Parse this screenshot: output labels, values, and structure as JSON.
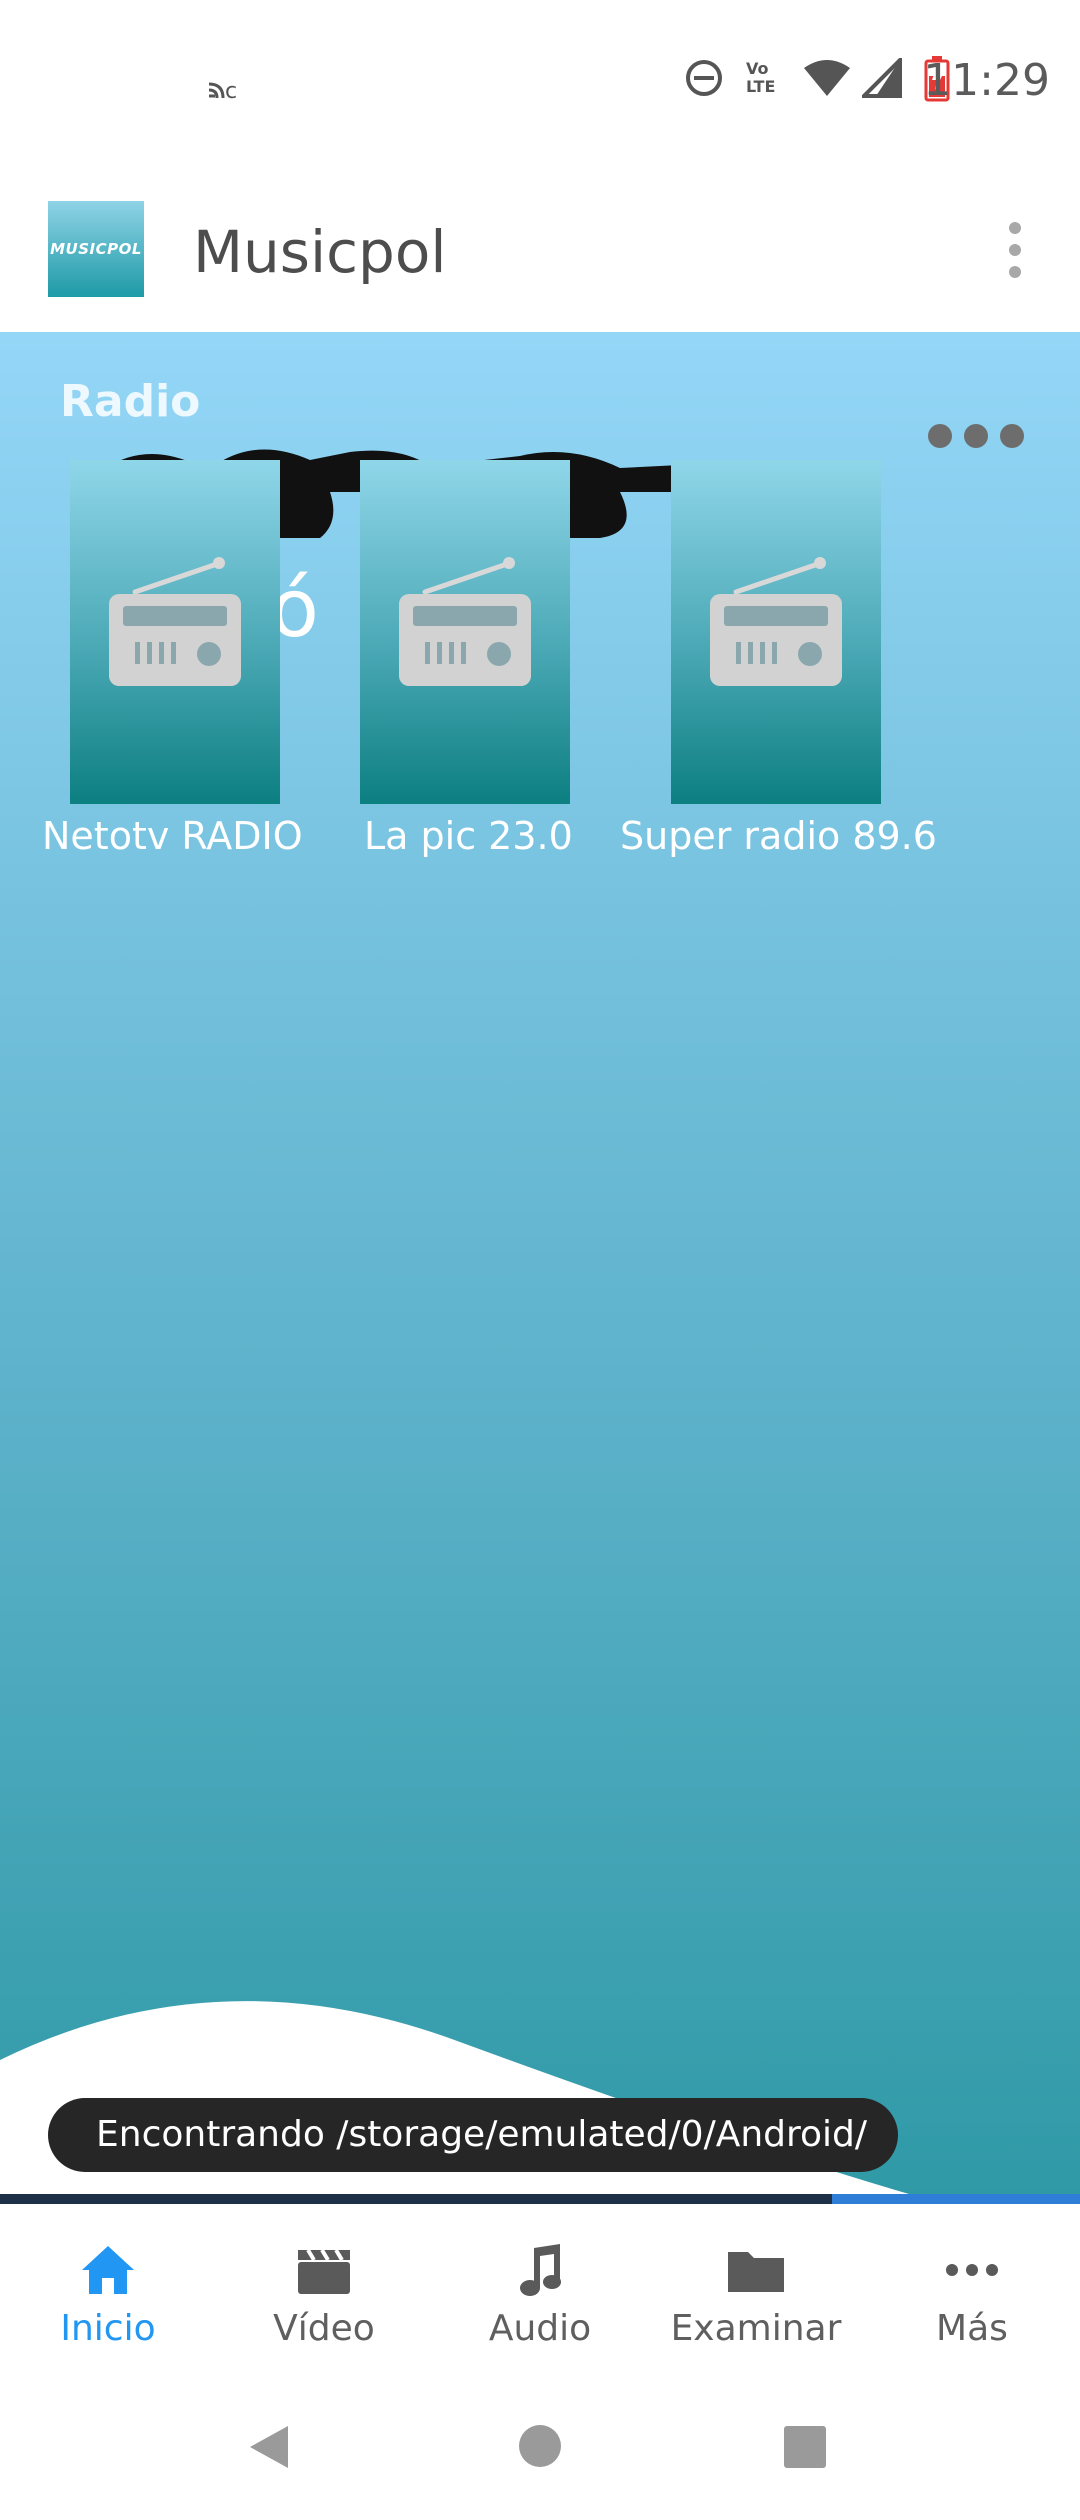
{
  "status_bar": {
    "time": "11:29",
    "network_label": "Vo LTE",
    "icons": [
      "cast-icon",
      "do-not-disturb-icon",
      "volte-icon",
      "wifi-icon",
      "cellular-signal-icon",
      "battery-charging-icon"
    ]
  },
  "app_bar": {
    "logo_text": "MUSICPOL",
    "title": "Musicpol"
  },
  "main": {
    "section_title": "Radio",
    "background_text": "ó",
    "stations": [
      {
        "label": "Netotv RADIO"
      },
      {
        "label": "La pic 23.0"
      },
      {
        "label": "Super radio 89.6"
      }
    ]
  },
  "toast": {
    "text": "Encontrando /storage/emulated/0/Android/"
  },
  "progress": {
    "fraction": 0.23
  },
  "bottom_nav": {
    "items": [
      {
        "label": "Inicio",
        "icon": "home-icon",
        "active": true
      },
      {
        "label": "Vídeo",
        "icon": "clapperboard-icon",
        "active": false
      },
      {
        "label": "Audio",
        "icon": "music-note-icon",
        "active": false
      },
      {
        "label": "Examinar",
        "icon": "folder-icon",
        "active": false
      },
      {
        "label": "Más",
        "icon": "more-horizontal-icon",
        "active": false
      }
    ]
  },
  "colors": {
    "accent": "#2196f3",
    "toolbar_text": "#4d4d4d",
    "toast_bg": "#262626"
  }
}
